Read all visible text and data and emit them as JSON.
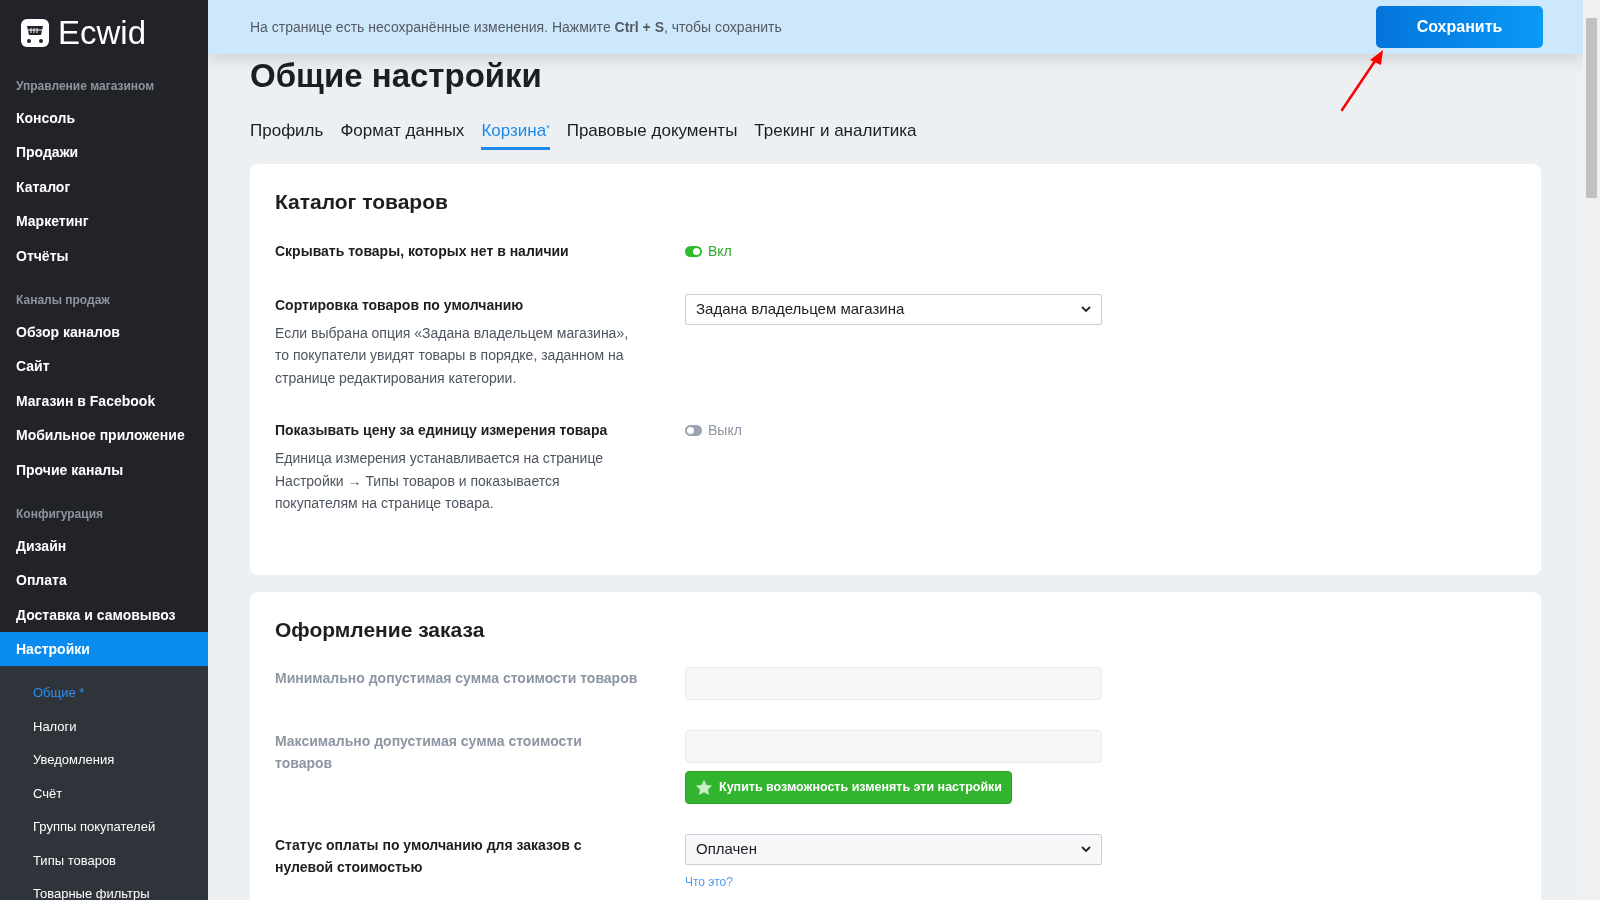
{
  "sidebar": {
    "logo": "Ecwid",
    "groups": [
      {
        "heading": "Управление магазином",
        "items": [
          {
            "label": "Консоль",
            "selected": false
          },
          {
            "label": "Продажи",
            "selected": false
          },
          {
            "label": "Каталог",
            "selected": false
          },
          {
            "label": "Маркетинг",
            "selected": false
          },
          {
            "label": "Отчёты",
            "selected": false
          }
        ]
      },
      {
        "heading": "Каналы продаж",
        "items": [
          {
            "label": "Обзор каналов",
            "selected": false
          },
          {
            "label": "Сайт",
            "selected": false
          },
          {
            "label": "Магазин в Facebook",
            "selected": false
          },
          {
            "label": "Мобильное приложение",
            "selected": false
          },
          {
            "label": "Прочие каналы",
            "selected": false
          }
        ]
      },
      {
        "heading": "Конфигурация",
        "items": [
          {
            "label": "Дизайн",
            "selected": false
          },
          {
            "label": "Оплата",
            "selected": false
          },
          {
            "label": "Доставка и самовывоз",
            "selected": false
          },
          {
            "label": "Настройки",
            "selected": true,
            "children": [
              {
                "label": "Общие *",
                "selected": true
              },
              {
                "label": "Налоги",
                "selected": false
              },
              {
                "label": "Уведомления",
                "selected": false
              },
              {
                "label": "Счёт",
                "selected": false
              },
              {
                "label": "Группы покупателей",
                "selected": false
              },
              {
                "label": "Типы товаров",
                "selected": false
              },
              {
                "label": "Товарные фильтры",
                "selected": false
              }
            ]
          }
        ]
      }
    ]
  },
  "banner": {
    "message": "На странице есть несохранённые изменения. Нажмите **Ctrl + S**, чтобы сохранить",
    "button": "Сохранить"
  },
  "page_title": "Общие настройки",
  "tabs": [
    {
      "label": "Профиль",
      "selected": false
    },
    {
      "label": "Формат данных",
      "selected": false
    },
    {
      "label": "Корзина$^{*}$",
      "selected": true
    },
    {
      "label": "Правовые документы",
      "selected": false
    },
    {
      "label": "Трекинг и аналитика",
      "selected": false
    }
  ],
  "sections": [
    {
      "title": "Каталог товаров",
      "rows": [
        {
          "kind": "toggle",
          "label": "Скрывать товары, которых нет в наличии",
          "disabled": false,
          "on": true,
          "state_text": "Вкл"
        },
        {
          "kind": "select",
          "label": "Сортировка товаров по умолчанию",
          "disabled": false,
          "value": "Задана владельцем магазина",
          "description": "Если выбрана опция «Задана владельцем магазина», то покупатели увидят товары в порядке, заданном на странице редактирования категории."
        },
        {
          "kind": "toggle",
          "label": "Показывать цену за единицу измерения товара",
          "disabled": false,
          "on": false,
          "state_text": "Выкл",
          "description": "Единица измерения устанавливается на странице Настройки → Типы товаров и показывается покупателям на странице товара."
        }
      ]
    },
    {
      "title": "Оформление заказа",
      "rows": [
        {
          "kind": "input",
          "label": "Минимально допустимая сумма стоимости товаров",
          "disabled": true
        },
        {
          "kind": "input",
          "label": "Максимально допустимая сумма стоимости товаров",
          "disabled": true,
          "upgrade_button": "Купить возможность изменять эти настройки"
        },
        {
          "kind": "select",
          "label": "Статус оплаты по умолчанию для заказов с нулевой стоимостью",
          "disabled": false,
          "value": "Оплачен",
          "help_link": "Что это?"
        }
      ]
    }
  ]
}
